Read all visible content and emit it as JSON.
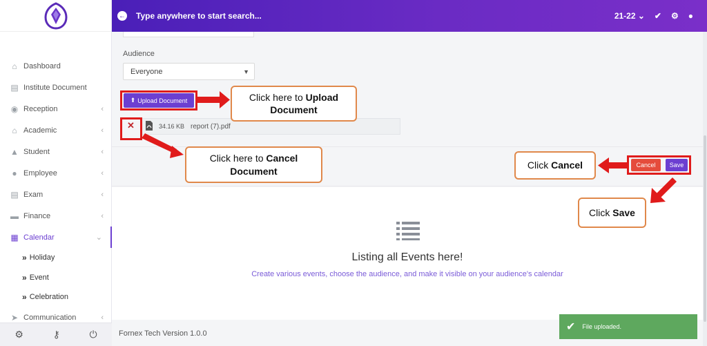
{
  "header": {
    "search_placeholder": "Type anywhere to start search...",
    "session": "21-22"
  },
  "sidebar": {
    "items": [
      {
        "label": "Dashboard",
        "icon": "home-icon",
        "chevron": ""
      },
      {
        "label": "Institute Document",
        "icon": "file-icon",
        "chevron": ""
      },
      {
        "label": "Reception",
        "icon": "user-circle-icon",
        "chevron": "‹"
      },
      {
        "label": "Academic",
        "icon": "school-icon",
        "chevron": "‹"
      },
      {
        "label": "Student",
        "icon": "graduation-cap-icon",
        "chevron": "‹"
      },
      {
        "label": "Employee",
        "icon": "user-icon",
        "chevron": "‹"
      },
      {
        "label": "Exam",
        "icon": "file-text-icon",
        "chevron": "‹"
      },
      {
        "label": "Finance",
        "icon": "money-icon",
        "chevron": "‹"
      },
      {
        "label": "Calendar",
        "icon": "calendar-icon",
        "chevron": "⌄"
      }
    ],
    "subitems": [
      "Holiday",
      "Event",
      "Celebration"
    ],
    "last_item": {
      "label": "Communication",
      "icon": "send-icon",
      "chevron": "‹"
    }
  },
  "form": {
    "audience_label": "Audience",
    "audience_value": "Everyone",
    "upload_label": "Upload Document",
    "file": {
      "size": "34.16 KB",
      "name": "report (7).pdf"
    },
    "cancel_label": "Cancel",
    "save_label": "Save"
  },
  "empty_state": {
    "title": "Listing all Events here!",
    "subtitle": "Create various events, choose the audience, and make it visible on your audience's calendar"
  },
  "footer": {
    "version_text": "Fornex Tech Version 1.0.0"
  },
  "toast": {
    "message": "File uploaded."
  },
  "callouts": {
    "upload": {
      "prefix": "Click here to ",
      "bold": "Upload Document"
    },
    "cancel_doc": {
      "prefix": "Click here to ",
      "bold": "Cancel Document"
    },
    "cancel": {
      "prefix": "Click ",
      "bold": "Cancel"
    },
    "save": {
      "prefix": "Click ",
      "bold": "Save"
    }
  },
  "colors": {
    "brand": "#6c3fd1",
    "annotation_red": "#e01b1b",
    "callout_border": "#e0884a",
    "toast": "#5ea85e"
  }
}
